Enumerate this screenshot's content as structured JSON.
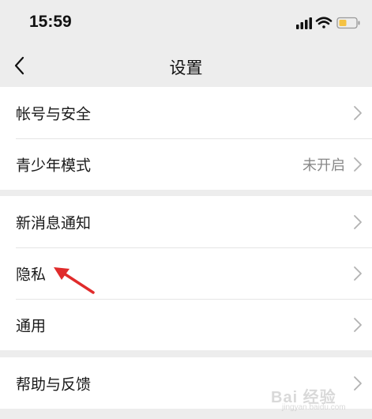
{
  "status_bar": {
    "time": "15:59",
    "icons": [
      "signal-icon",
      "wifi-icon",
      "battery-icon"
    ],
    "battery_color": "#f5c242"
  },
  "nav": {
    "title": "设置",
    "back_icon": "chevron-left-icon"
  },
  "groups": [
    {
      "items": [
        {
          "label": "帐号与安全",
          "value": ""
        },
        {
          "label": "青少年模式",
          "value": "未开启"
        }
      ]
    },
    {
      "items": [
        {
          "label": "新消息通知",
          "value": ""
        },
        {
          "label": "隐私",
          "value": ""
        },
        {
          "label": "通用",
          "value": ""
        }
      ]
    },
    {
      "items": [
        {
          "label": "帮助与反馈",
          "value": ""
        }
      ]
    }
  ],
  "annotation": {
    "arrow_color": "#e02b2b"
  },
  "watermark": {
    "main": "Bai 经验",
    "sub": "jingyan.baidu.com"
  }
}
